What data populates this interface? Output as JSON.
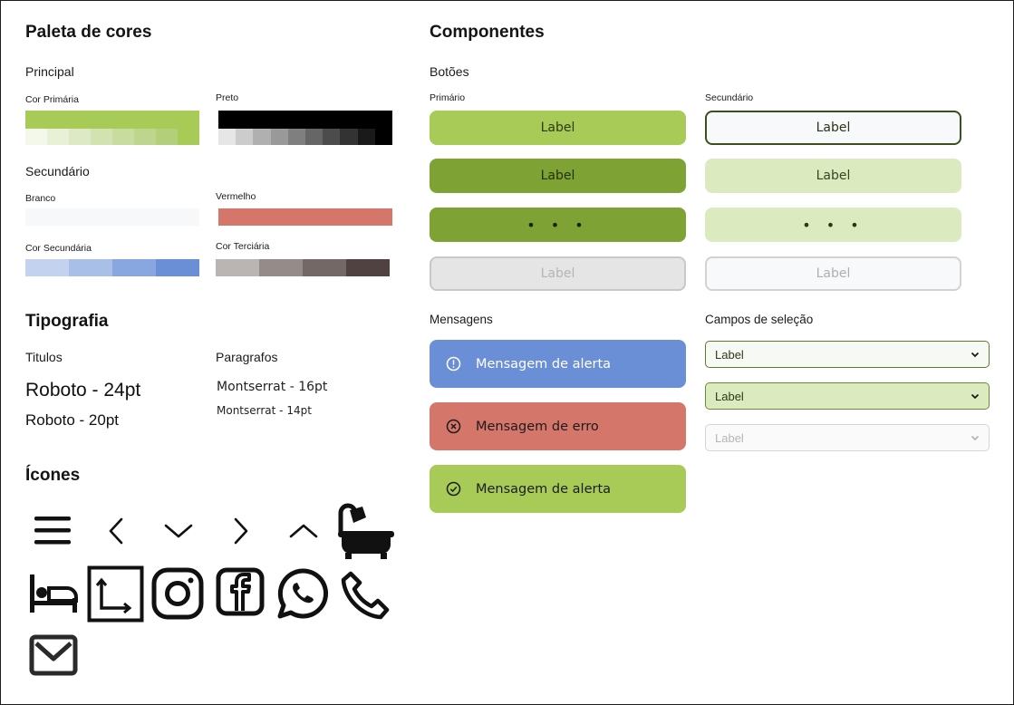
{
  "palette": {
    "title": "Paleta de cores",
    "principal_label": "Principal",
    "primary_label": "Cor Primária",
    "preto_label": "Preto",
    "secundario_label": "Secundário",
    "branco_label": "Branco",
    "vermelho_label": "Vermelho",
    "cor_secundaria_label": "Cor Secundária",
    "cor_terciaria_label": "Cor Terciária",
    "primary_color": "#a8cb57",
    "primary_shades": [
      "#f3f8ea",
      "#e8f1d6",
      "#dde9c4",
      "#d2e2b1",
      "#c8dc9f",
      "#bdd58c",
      "#b3cf7a",
      "#a8cb57"
    ],
    "black_color": "#000000",
    "black_shades": [
      "#e6e6e6",
      "#cccccc",
      "#b0b0b0",
      "#999999",
      "#7f7f7f",
      "#666666",
      "#4c4c4c",
      "#333333",
      "#1a1a1a",
      "#000000"
    ],
    "white_color": "#f7f8f9",
    "red_color": "#d4766a",
    "secondary_shades": [
      "#c3d3ef",
      "#a8bfe8",
      "#88a6df",
      "#6a8fd6"
    ],
    "tertiary_shades": [
      "#bab4b2",
      "#958b89",
      "#736865",
      "#4f4240"
    ]
  },
  "typography": {
    "title": "Tipografia",
    "titulos_label": "Titulos",
    "paragrafos_label": "Paragrafos",
    "sample_24": "Roboto - 24pt",
    "sample_20": "Roboto - 20pt",
    "sample_16": "Montserrat - 16pt",
    "sample_14": "Montserrat - 14pt"
  },
  "icons": {
    "title": "Ícones",
    "list": [
      "menu-icon",
      "chevron-left-icon",
      "chevron-down-icon",
      "chevron-right-icon",
      "chevron-up-icon",
      "bathtub-icon",
      "bed-icon",
      "area-icon",
      "instagram-icon",
      "facebook-icon",
      "whatsapp-icon",
      "phone-icon",
      "mail-icon"
    ]
  },
  "components": {
    "title": "Componentes",
    "buttons_label": "Botões",
    "primary_label": "Primário",
    "secondary_label": "Secundário",
    "primary_buttons": [
      "Label",
      "Label",
      "• • •",
      "Label"
    ],
    "secondary_buttons": [
      "Label",
      "Label",
      "• • •",
      "Label"
    ],
    "messages_label": "Mensagens",
    "messages": [
      "Mensagem de alerta",
      "Mensagem de erro",
      "Mensagem de alerta"
    ],
    "selects_label": "Campos de seleção",
    "selects": [
      "Label",
      "Label",
      "Label"
    ]
  }
}
